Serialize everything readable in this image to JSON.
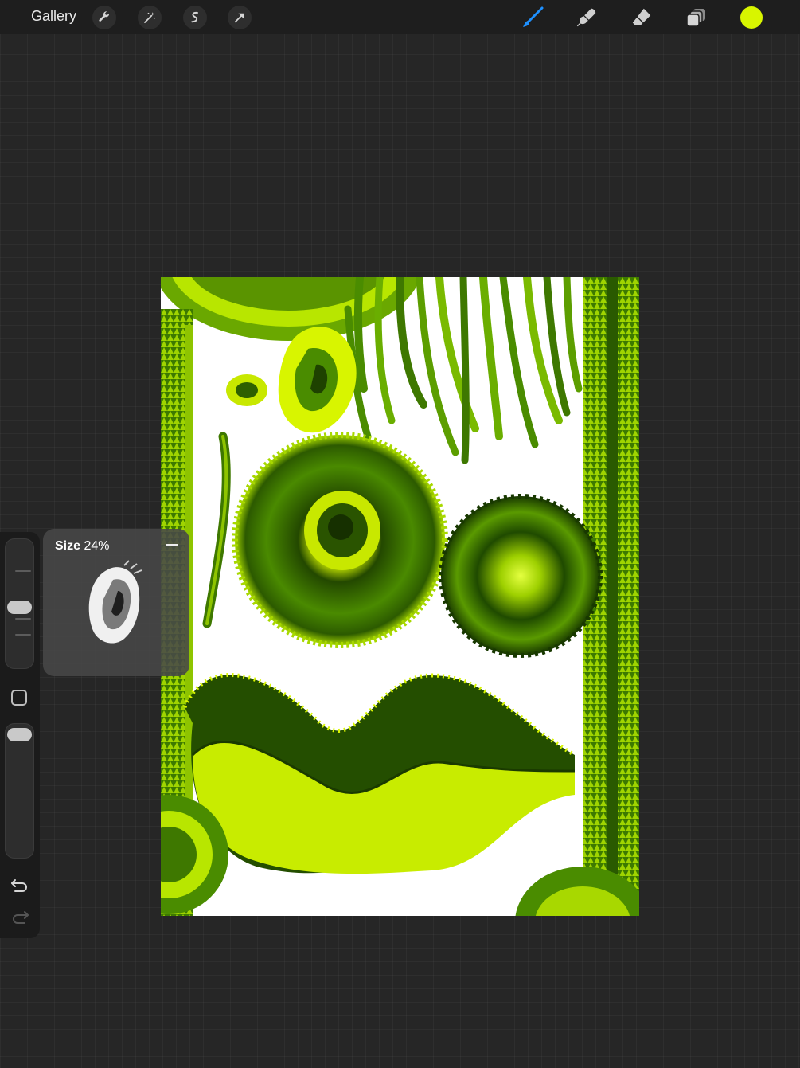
{
  "topbar": {
    "gallery_label": "Gallery",
    "left_tools": [
      "wrench-icon",
      "magic-wand-icon",
      "selection-icon",
      "transform-arrow-icon"
    ],
    "right_tools": [
      "brush-icon",
      "smudge-icon",
      "eraser-icon",
      "layers-icon"
    ],
    "active_tool": "brush-icon",
    "active_color": "#d8f500",
    "accent": "#1e90ff"
  },
  "size_popup": {
    "label": "Size",
    "value": "24%"
  },
  "sidebar": {
    "size_slider_fraction": 0.24,
    "opacity_slider_fraction": 1.0
  }
}
